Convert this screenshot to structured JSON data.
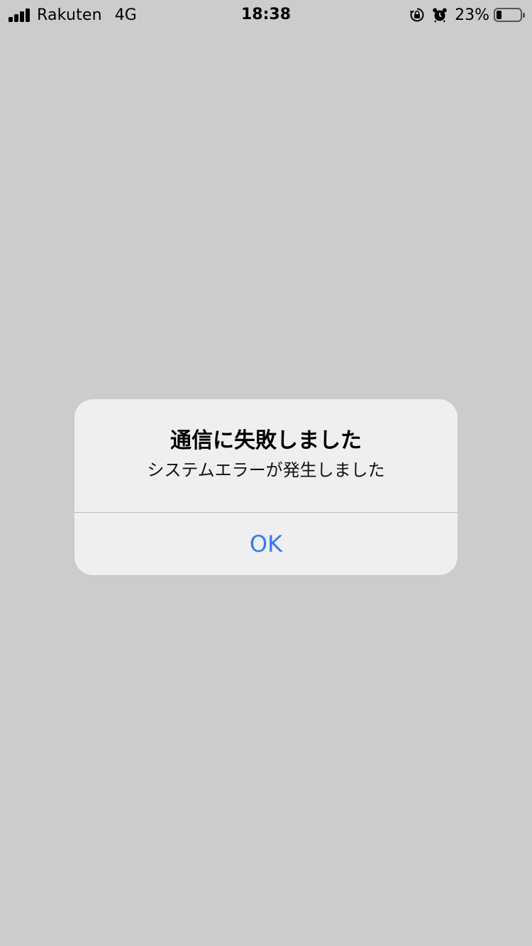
{
  "status_bar": {
    "carrier": "Rakuten",
    "network": "4G",
    "time": "18:38",
    "battery_percent": "23%",
    "battery_level": 0.23,
    "icons": {
      "signal": "signal-bars-icon",
      "rotation_lock": "rotation-lock-icon",
      "alarm": "alarm-clock-icon",
      "battery": "battery-icon"
    }
  },
  "alert": {
    "title": "通信に失敗しました",
    "message": "システムエラーが発生しました",
    "button_label": "OK"
  },
  "colors": {
    "background": "#cccccc",
    "alert_background": "#efefef",
    "accent": "#3478f6"
  }
}
